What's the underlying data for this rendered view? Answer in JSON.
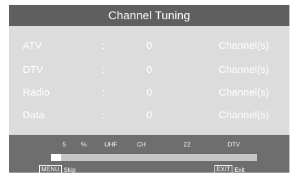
{
  "title": "Channel Tuning",
  "rows": [
    {
      "label": "ATV",
      "sep": ":",
      "count": "0",
      "unit": "Channel(s)"
    },
    {
      "label": "DTV",
      "sep": ":",
      "count": "0",
      "unit": "Channel(s)"
    },
    {
      "label": "Radio",
      "sep": ":",
      "count": "0",
      "unit": "Channel(s)"
    },
    {
      "label": "Data",
      "sep": ":",
      "count": "0",
      "unit": "Channel(s)"
    }
  ],
  "status": {
    "percent": "5",
    "percent_sign": "%",
    "band": "UHF",
    "ch_label": "CH",
    "channel": "22",
    "mode": "DTV",
    "progress_fraction": 0.05
  },
  "hints": {
    "menu_key": "MENU",
    "menu_action": "Skip",
    "exit_key": "EXIT",
    "exit_action": "Exit"
  }
}
